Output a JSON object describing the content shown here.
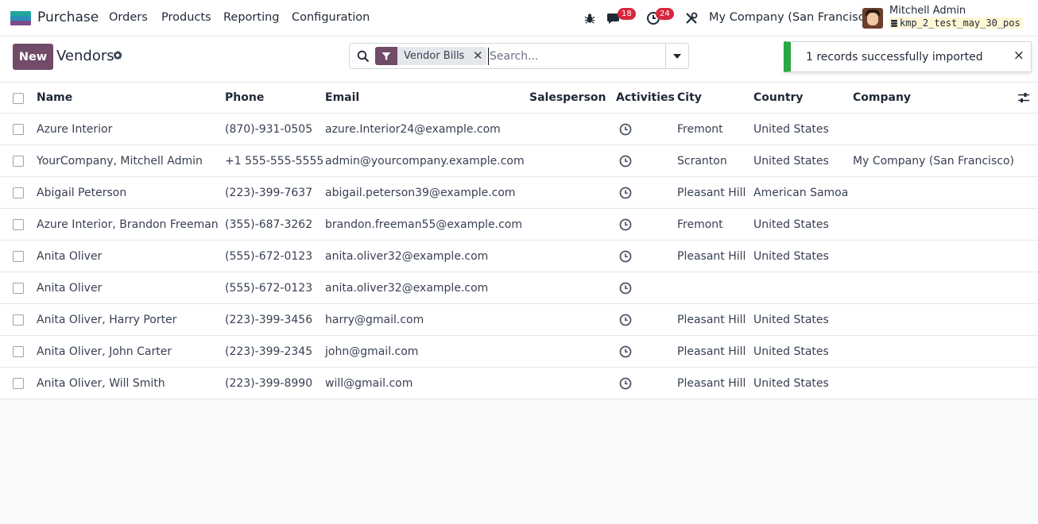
{
  "topbar": {
    "app_name": "Purchase",
    "menu": [
      "Orders",
      "Products",
      "Reporting",
      "Configuration"
    ],
    "messages_badge": "18",
    "activities_badge": "24",
    "company": "My Company (San Francisco)",
    "user_name": "Mitchell Admin",
    "database": "kmp_2_test_may_30_pos"
  },
  "control": {
    "new_label": "New",
    "title": "Vendors",
    "facet_label": "Vendor Bills",
    "search_placeholder": "Search..."
  },
  "toast": {
    "message": "1 records successfully imported",
    "close": "×"
  },
  "table": {
    "columns": [
      "Name",
      "Phone",
      "Email",
      "Salesperson",
      "Activities",
      "City",
      "Country",
      "Company"
    ],
    "rows": [
      {
        "name": "Azure Interior",
        "phone": "(870)-931-0505",
        "email": "azure.Interior24@example.com",
        "salesperson": "",
        "city": "Fremont",
        "country": "United States",
        "company": ""
      },
      {
        "name": "YourCompany, Mitchell Admin",
        "phone": "+1 555-555-5555",
        "email": "admin@yourcompany.example.com",
        "salesperson": "",
        "city": "Scranton",
        "country": "United States",
        "company": "My Company (San Francisco)"
      },
      {
        "name": "Abigail Peterson",
        "phone": "(223)-399-7637",
        "email": "abigail.peterson39@example.com",
        "salesperson": "",
        "city": "Pleasant Hill",
        "country": "American Samoa",
        "company": ""
      },
      {
        "name": "Azure Interior, Brandon Freeman",
        "phone": "(355)-687-3262",
        "email": "brandon.freeman55@example.com",
        "salesperson": "",
        "city": "Fremont",
        "country": "United States",
        "company": ""
      },
      {
        "name": "Anita Oliver",
        "phone": "(555)-672-0123",
        "email": "anita.oliver32@example.com",
        "salesperson": "",
        "city": "Pleasant Hill",
        "country": "United States",
        "company": ""
      },
      {
        "name": "Anita Oliver",
        "phone": "(555)-672-0123",
        "email": "anita.oliver32@example.com",
        "salesperson": "",
        "city": "",
        "country": "",
        "company": ""
      },
      {
        "name": "Anita Oliver, Harry Porter",
        "phone": "(223)-399-3456",
        "email": "harry@gmail.com",
        "salesperson": "",
        "city": "Pleasant Hill",
        "country": "United States",
        "company": ""
      },
      {
        "name": "Anita Oliver, John Carter",
        "phone": "(223)-399-2345",
        "email": "john@gmail.com",
        "salesperson": "",
        "city": "Pleasant Hill",
        "country": "United States",
        "company": ""
      },
      {
        "name": "Anita Oliver, Will Smith",
        "phone": "(223)-399-8990",
        "email": "will@gmail.com",
        "salesperson": "",
        "city": "Pleasant Hill",
        "country": "United States",
        "company": ""
      }
    ]
  },
  "colors": {
    "brand": "#714b67",
    "badge": "#d7263d",
    "success": "#28a745"
  },
  "icons": [
    "app-logo-icon",
    "bug-icon",
    "chat-icon",
    "clock-icon",
    "tools-icon",
    "gear-icon",
    "search-icon",
    "filter-icon",
    "caret-down-icon",
    "close-icon",
    "sliders-icon",
    "database-icon"
  ]
}
